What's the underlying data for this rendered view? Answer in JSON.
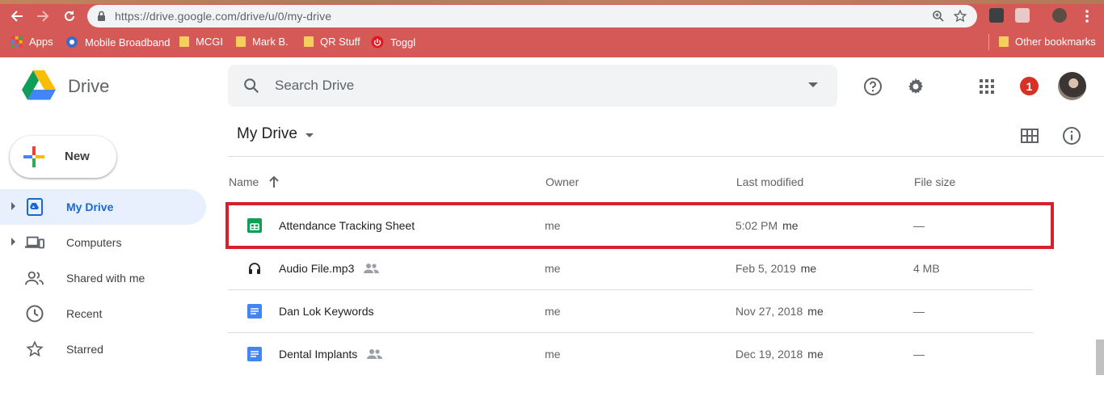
{
  "browser": {
    "url": "https://drive.google.com/drive/u/0/my-drive",
    "bookmarks": [
      {
        "label": "Apps",
        "icon": "apps-grid-icon"
      },
      {
        "label": "Mobile Broadband",
        "icon": "globe-icon"
      },
      {
        "label": "MCGI",
        "icon": "folder-icon"
      },
      {
        "label": "Mark B.",
        "icon": "folder-icon"
      },
      {
        "label": "QR Stuff",
        "icon": "folder-icon"
      },
      {
        "label": "Toggl",
        "icon": "toggl-icon"
      }
    ],
    "other_bookmarks": "Other bookmarks",
    "chrome_color": "#d55a57"
  },
  "header": {
    "product": "Drive",
    "search_placeholder": "Search Drive",
    "notification_count": "1"
  },
  "sidebar": {
    "new_label": "New",
    "items": [
      {
        "label": "My Drive",
        "icon": "my-drive-icon",
        "active": true
      },
      {
        "label": "Computers",
        "icon": "computers-icon"
      },
      {
        "label": "Shared with me",
        "icon": "shared-people-icon"
      },
      {
        "label": "Recent",
        "icon": "clock-icon"
      },
      {
        "label": "Starred",
        "icon": "star-icon"
      }
    ]
  },
  "main": {
    "location": "My Drive",
    "columns": {
      "name": "Name",
      "owner": "Owner",
      "modified": "Last modified",
      "size": "File size"
    },
    "files": [
      {
        "name": "Attendance Tracking Sheet",
        "type": "sheets",
        "shared": false,
        "owner": "me",
        "modified": "5:02 PM",
        "modified_by": "me",
        "size": "—",
        "highlighted": true
      },
      {
        "name": "Audio File.mp3",
        "type": "audio",
        "shared": true,
        "owner": "me",
        "modified": "Feb 5, 2019",
        "modified_by": "me",
        "size": "4 MB"
      },
      {
        "name": "Dan Lok Keywords",
        "type": "docs",
        "shared": false,
        "owner": "me",
        "modified": "Nov 27, 2018",
        "modified_by": "me",
        "size": "—"
      },
      {
        "name": "Dental Implants",
        "type": "docs",
        "shared": true,
        "owner": "me",
        "modified": "Dec 19, 2018",
        "modified_by": "me",
        "size": "—"
      }
    ],
    "highlight_color": "#d6202c"
  }
}
